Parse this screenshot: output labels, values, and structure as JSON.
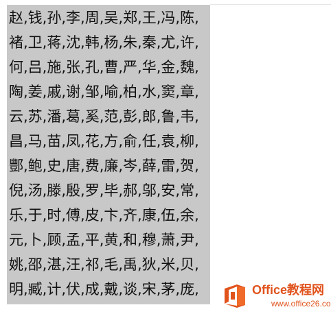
{
  "document": {
    "lines": [
      "赵,钱,孙,李,周,吴,郑,王,冯,陈,",
      "褚,卫,蒋,沈,韩,杨,朱,秦,尤,许,",
      "何,吕,施,张,孔,曹,严,华,金,魏,",
      "陶,姜,戚,谢,邹,喻,柏,水,窦,章,",
      "云,苏,潘,葛,奚,范,彭,郎,鲁,韦,",
      "昌,马,苗,凤,花,方,俞,任,袁,柳,",
      "酆,鲍,史,唐,费,廉,岑,薛,雷,贺,",
      "倪,汤,滕,殷,罗,毕,郝,邬,安,常,",
      "乐,于,时,傅,皮,卞,齐,康,伍,余,",
      "元,卜,顾,孟,平,黄,和,穆,萧,尹,",
      "姚,邵,湛,汪,祁,毛,禹,狄,米,贝,",
      "明,臧,计,伏,成,戴,谈,宋,茅,庞,"
    ],
    "selection_color": "#c8c8c8"
  },
  "watermark": {
    "title": "Office教程网",
    "url": "www.office26.com",
    "brand_color": "#e0531c"
  }
}
